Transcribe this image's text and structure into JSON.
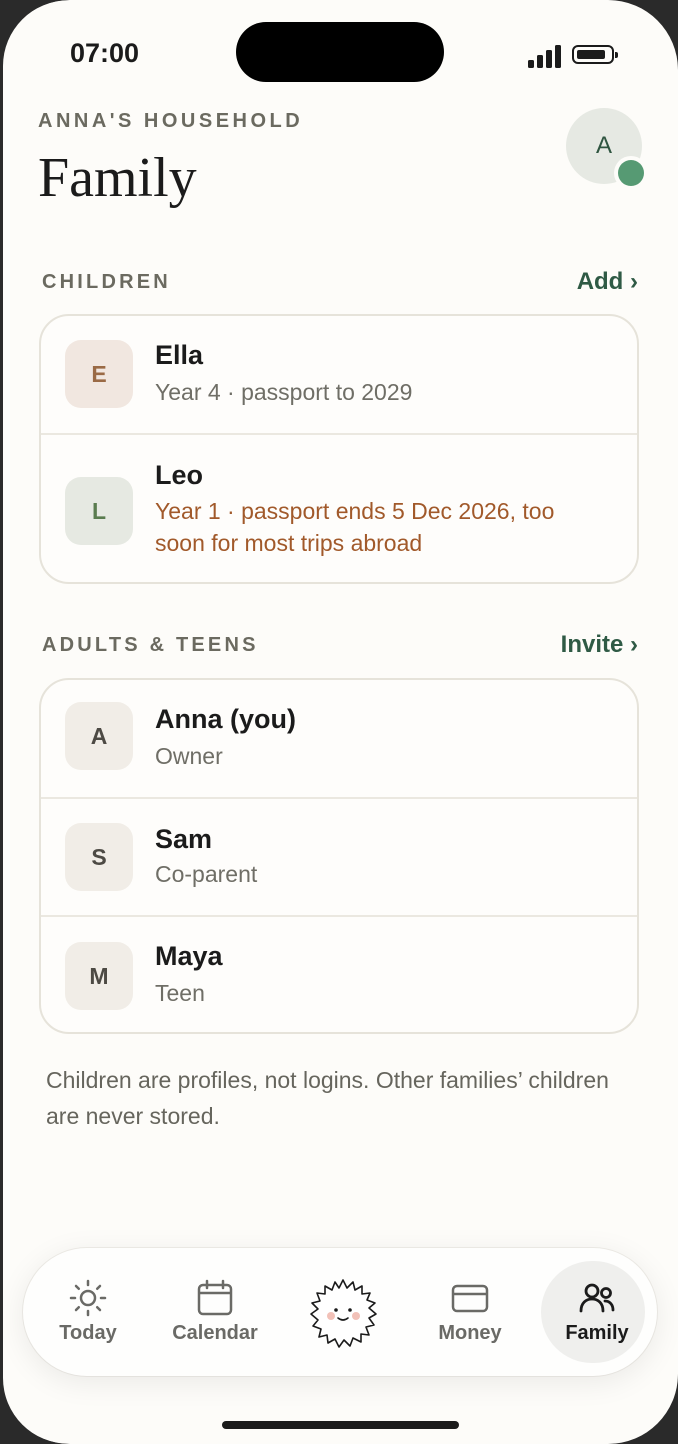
{
  "status": {
    "time": "07:00"
  },
  "header": {
    "household": "ANNA'S HOUSEHOLD",
    "title": "Family",
    "avatar_initial": "A"
  },
  "children": {
    "label": "CHILDREN",
    "action": "Add ›",
    "items": [
      {
        "initial": "E",
        "name": "Ella",
        "detail": "Year 4 · passport to 2029"
      },
      {
        "initial": "L",
        "name": "Leo",
        "detail": "Year 1 · passport ends 5 Dec 2026, too soon for most trips abroad"
      }
    ]
  },
  "adults": {
    "label": "ADULTS & TEENS",
    "action": "Invite ›",
    "items": [
      {
        "initial": "A",
        "name": "Anna (you)",
        "detail": "Owner"
      },
      {
        "initial": "S",
        "name": "Sam",
        "detail": "Co-parent"
      },
      {
        "initial": "M",
        "name": "Maya",
        "detail": "Teen"
      }
    ]
  },
  "footnote": "Children are profiles, not logins. Other families’ children are never stored.",
  "tabs": [
    {
      "label": "Today",
      "icon": "sun-icon"
    },
    {
      "label": "Calendar",
      "icon": "calendar-icon"
    },
    {
      "label": "",
      "icon": "mascot-icon"
    },
    {
      "label": "Money",
      "icon": "card-icon"
    },
    {
      "label": "Family",
      "icon": "people-icon",
      "active": true
    }
  ],
  "colors": {
    "accent": "#2f5a45",
    "warning": "#a1592a",
    "presence": "#569a73"
  }
}
